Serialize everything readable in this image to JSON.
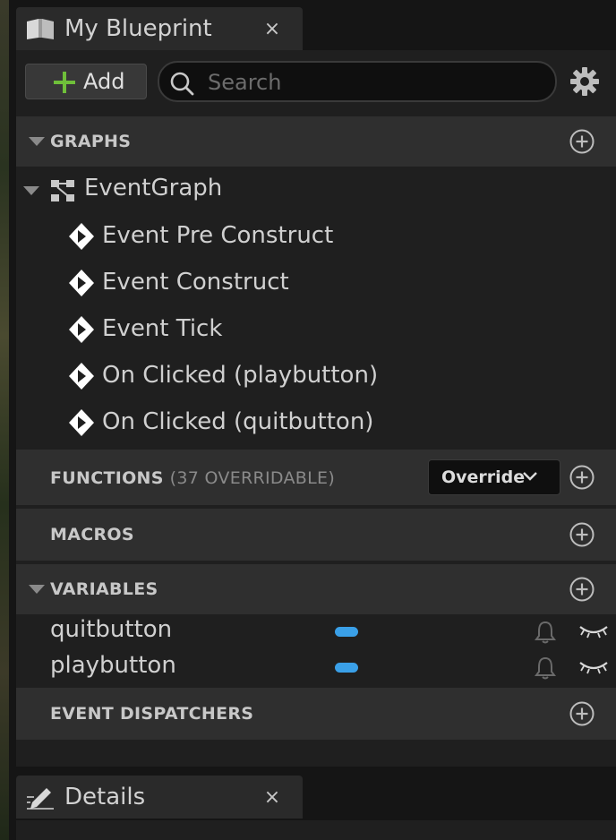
{
  "blueprint_tab": {
    "title": "My Blueprint",
    "close": "×"
  },
  "toolbar": {
    "add_label": "Add",
    "search_placeholder": "Search",
    "search_value": ""
  },
  "graphs": {
    "header": "GRAPHS",
    "graph_name": "EventGraph",
    "events": [
      "Event Pre Construct",
      "Event Construct",
      "Event Tick",
      "On Clicked (playbutton)",
      "On Clicked (quitbutton)"
    ]
  },
  "functions": {
    "header": "FUNCTIONS",
    "sub": "(37 OVERRIDABLE)",
    "override_label": "Override"
  },
  "macros": {
    "header": "MACROS"
  },
  "variables": {
    "header": "VARIABLES",
    "items": [
      {
        "name": "quitbutton",
        "type_color": "#3aa0e8"
      },
      {
        "name": "playbutton",
        "type_color": "#3aa0e8"
      }
    ]
  },
  "event_dispatchers": {
    "header": "EVENT DISPATCHERS"
  },
  "details_tab": {
    "title": "Details",
    "close": "×"
  },
  "colors": {
    "accent_green": "#6fbf3a",
    "variable_pill": "#3aa0e8",
    "panel_bg": "#1f1f1f",
    "header_bg": "#2f2f2f"
  }
}
